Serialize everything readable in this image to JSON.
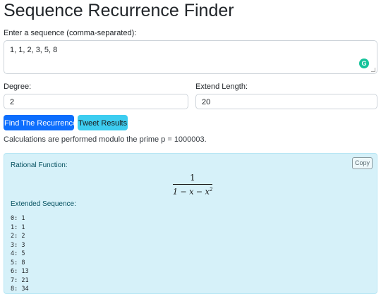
{
  "header": {
    "title": "Sequence Recurrence Finder"
  },
  "sequence": {
    "label": "Enter a sequence (comma-separated):",
    "value": "1, 1, 2, 3, 5, 8"
  },
  "degree": {
    "label": "Degree:",
    "value": "2"
  },
  "extend": {
    "label": "Extend Length:",
    "value": "20"
  },
  "buttons": {
    "find": "Find The Recurrence",
    "tweet": "Tweet Results"
  },
  "note": "Calculations are performed modulo the prime p = 1000003.",
  "result": {
    "copy_label": "Copy",
    "rational_label": "Rational Function:",
    "numerator": "1",
    "denominator_main": "1 − x − x",
    "denominator_exp": "2",
    "extended_label": "Extended Sequence:",
    "terms": [
      "0: 1",
      "1: 1",
      "2: 2",
      "3: 3",
      "4: 5",
      "5: 8",
      "6: 13",
      "7: 21",
      "8: 34"
    ]
  },
  "colors": {
    "primary": "#0d6efd",
    "info": "#3dcdf0",
    "result_bg": "#d6f1f9"
  }
}
